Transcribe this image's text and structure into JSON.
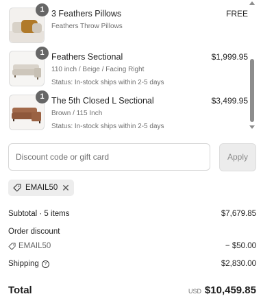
{
  "cart": {
    "items": [
      {
        "quantity": "1",
        "name": "3 Feathers Pillows",
        "details": [
          "Feathers Throw Pillows"
        ],
        "price": "FREE",
        "thumbnail": "pillows"
      },
      {
        "quantity": "1",
        "name": "Feathers Sectional",
        "details": [
          "110 inch / Beige / Facing Right",
          "Status: In-stock ships within 2-5 days"
        ],
        "price": "$1,999.95",
        "thumbnail": "beige-sectional-sofa"
      },
      {
        "quantity": "1",
        "name": "The 5th Closed L Sectional",
        "details": [
          "Brown / 115 Inch",
          "Status: In-stock ships within 2-5 days"
        ],
        "price": "$3,499.95",
        "thumbnail": "brown-l-sectional-sofa"
      }
    ]
  },
  "discount": {
    "placeholder": "Discount code or gift card",
    "apply_label": "Apply",
    "applied_code": "EMAIL50",
    "tag_icon": "tag-icon",
    "remove_icon": "close-icon"
  },
  "summary": {
    "subtotal_label": "Subtotal · 5 items",
    "subtotal_value": "$7,679.85",
    "order_discount_label": "Order discount",
    "discount_code": "EMAIL50",
    "discount_value": "− $50.00",
    "shipping_label": "Shipping",
    "shipping_help_icon": "question-circle-icon",
    "shipping_value": "$2,830.00",
    "total_label": "Total",
    "currency": "USD",
    "total_value": "$10,459.85"
  },
  "colors": {
    "badge": "#666666",
    "chip_background": "#ededed",
    "apply_disabled": "#ececec",
    "muted_text": "#707070"
  }
}
